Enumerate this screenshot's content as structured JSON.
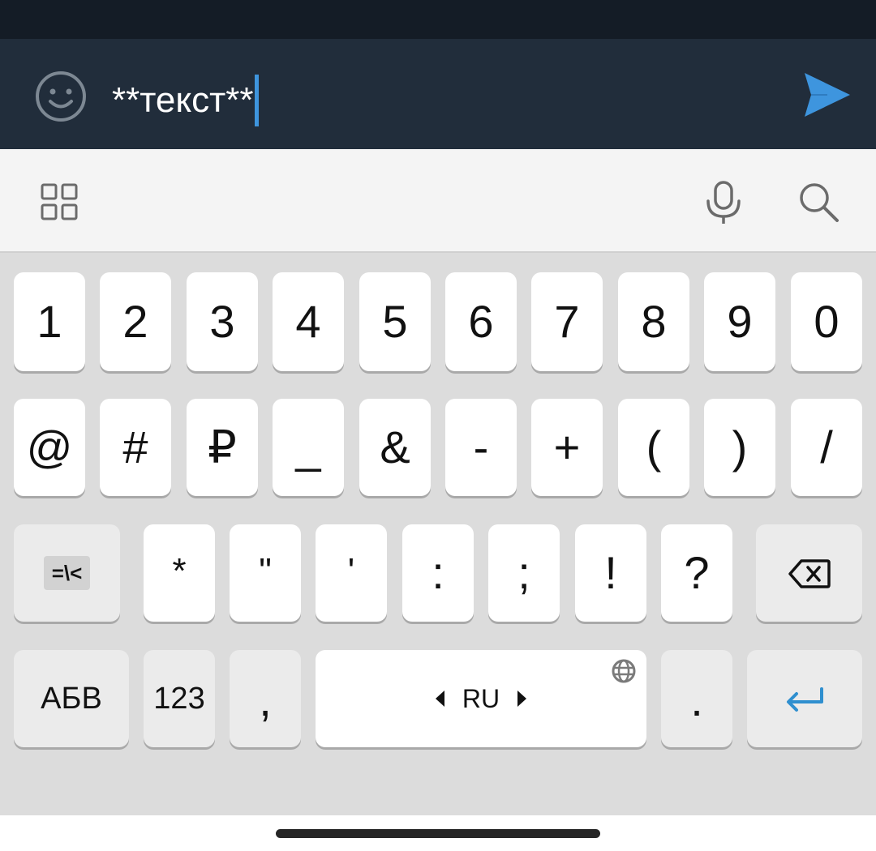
{
  "compose": {
    "message_text": "**текст**",
    "icons": {
      "emoji": "smiley-face-icon",
      "send": "send-arrow-icon"
    },
    "colors": {
      "bar_background": "#212d3b",
      "send_accent": "#3e95de",
      "caret": "#3e95de"
    }
  },
  "toolbar": {
    "icons": [
      "grid-menu-icon",
      "microphone-icon",
      "search-icon"
    ]
  },
  "keyboard": {
    "row1": [
      "1",
      "2",
      "3",
      "4",
      "5",
      "6",
      "7",
      "8",
      "9",
      "0"
    ],
    "row2": [
      "@",
      "#",
      "₽",
      "_",
      "&",
      "-",
      "+",
      "(",
      ")",
      "/"
    ],
    "row3": {
      "switch_symbols": "=\\<",
      "keys": [
        "*",
        "\"",
        "'",
        ":",
        ";",
        "!",
        "?"
      ],
      "backspace_icon": "backspace-icon"
    },
    "row4": {
      "alpha_switch": "АБВ",
      "numeric_switch": "123",
      "comma": ",",
      "space_language": "RU",
      "language_icon": "globe-icon",
      "period": ".",
      "enter_icon": "enter-arrow-icon"
    }
  }
}
